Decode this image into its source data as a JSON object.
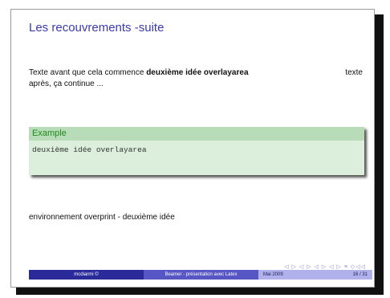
{
  "slide": {
    "title": "Les recouvrements -suite",
    "text_before": "Texte avant que cela commence",
    "overlay_bold": "deuxième idée overlayarea",
    "text_after_right": "texte",
    "text_after_line2": "après, ça continue ...",
    "example_title": "Example",
    "example_body": "deuxième idée overlayarea",
    "overprint_text": "environnement overprint - deuxième idée"
  },
  "footer": {
    "author": "mcdiarmi ©",
    "talk": "Beamer - présentation avec Latex",
    "date": "Mai 2009",
    "page": "16 / 31"
  },
  "nav": {
    "symbols": "◁ ▷ ◁ ▷ ◁ ▷ ◁ ▷ ≡ ◇◁◁"
  }
}
